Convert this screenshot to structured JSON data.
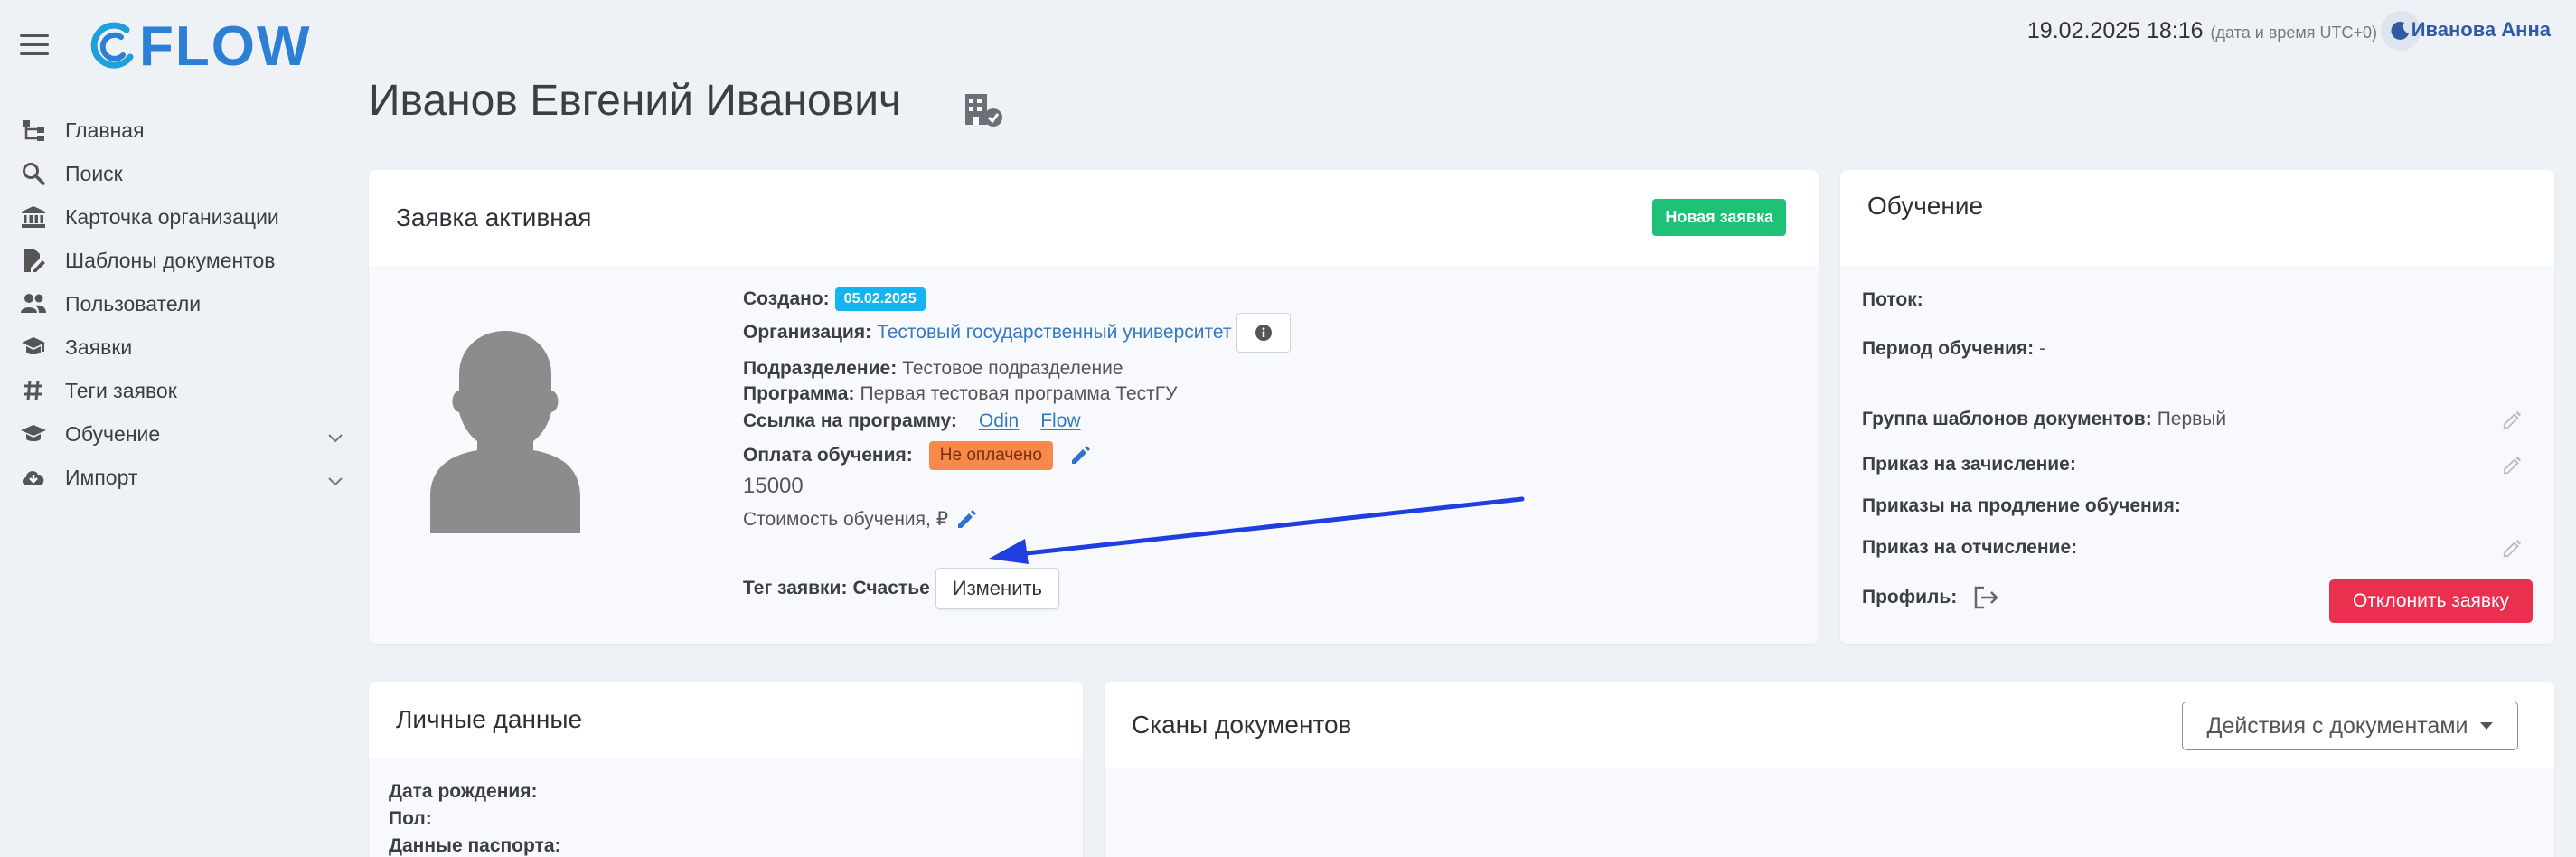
{
  "app": {
    "logo": "FLOW"
  },
  "header": {
    "datetime": "19.02.2025 18:16",
    "datetime_note": "(дата и время UTC+0)",
    "user": "Иванова Анна"
  },
  "sidebar": {
    "items": [
      {
        "label": "Главная",
        "icon": "hierarchy-icon"
      },
      {
        "label": "Поиск",
        "icon": "search-icon"
      },
      {
        "label": "Карточка организации",
        "icon": "bank-icon"
      },
      {
        "label": "Шаблоны документов",
        "icon": "file-edit-icon"
      },
      {
        "label": "Пользователи",
        "icon": "users-icon"
      },
      {
        "label": "Заявки",
        "icon": "graduation-icon"
      },
      {
        "label": "Теги заявок",
        "icon": "hashtag-icon"
      },
      {
        "label": "Обучение",
        "icon": "graduation-cap-icon",
        "expandable": true
      },
      {
        "label": "Импорт",
        "icon": "cloud-download-icon",
        "expandable": true
      }
    ]
  },
  "page": {
    "title": "Иванов Евгений Иванович"
  },
  "application": {
    "heading": "Заявка активная",
    "status_badge": "Новая заявка",
    "created_label": "Создано:",
    "created_date": "05.02.2025",
    "org_label": "Организация:",
    "org_value": "Тестовый государственный университет",
    "division_label": "Подразделение:",
    "division_value": "Тестовое подразделение",
    "program_label": "Программа:",
    "program_value": "Первая тестовая программа ТестГУ",
    "link_label": "Ссылка на программу:",
    "link_odin": "Odin",
    "link_flow": "Flow",
    "payment_label": "Оплата обучения:",
    "payment_status": "Не оплачено",
    "cost_amount": "15000",
    "cost_label": "Стоимость обучения, ₽",
    "tag_label": "Тег заявки:",
    "tag_value": "Счастье",
    "change_button": "Изменить"
  },
  "education": {
    "heading": "Обучение",
    "stream_label": "Поток:",
    "period_label": "Период обучения:",
    "period_value": "-",
    "template_group_label": "Группа шаблонов документов:",
    "template_group_value": "Первый",
    "enroll_order_label": "Приказ на зачисление:",
    "extension_orders_label": "Приказы на продление обучения:",
    "expel_order_label": "Приказ на отчисление:",
    "profile_label": "Профиль:",
    "reject_button": "Отклонить заявку"
  },
  "personal": {
    "heading": "Личные данные",
    "birth_label": "Дата рождения:",
    "gender_label": "Пол:",
    "passport_label": "Данные паспорта:"
  },
  "scans": {
    "heading": "Сканы документов",
    "actions_button": "Действия с документами"
  },
  "colors": {
    "accent": "#2b7fd4",
    "badge_new": "#1fc176",
    "badge_date": "#14b4f0",
    "badge_unpaid": "#f78a4b",
    "danger": "#ea2f4f",
    "annotation_arrow": "#1e3ee0"
  }
}
